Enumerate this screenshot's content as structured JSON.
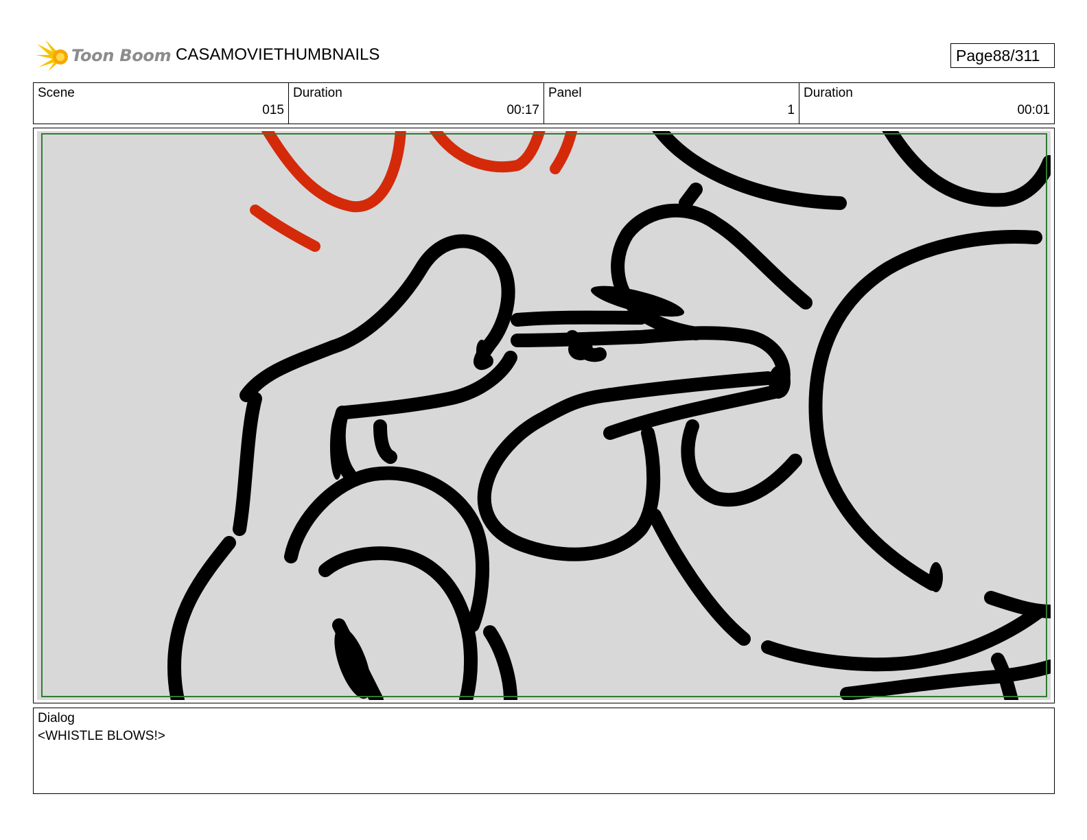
{
  "header": {
    "logo_text": "Toon Boom",
    "logo_icon": "toon-boom-burst-icon",
    "project_title": "CASAMOVIETHUMBNAILS",
    "page_label": "Page",
    "page_number": "88/311"
  },
  "info": {
    "scene_label": "Scene",
    "scene_value": "015",
    "scene_duration_label": "Duration",
    "scene_duration_value": "00:17",
    "panel_label": "Panel",
    "panel_value": "1",
    "panel_duration_label": "Duration",
    "panel_duration_value": "00:01"
  },
  "panel": {
    "drawing": "black brush-stroke thumbnail sketch with red motion accents",
    "ink_color": "#000000",
    "accent_color": "#d42a0a",
    "background_color": "#d8d8d8",
    "safe_frame_color": "#2f7d2f"
  },
  "dialog": {
    "label": "Dialog",
    "text": "<WHISTLE BLOWS!>"
  }
}
